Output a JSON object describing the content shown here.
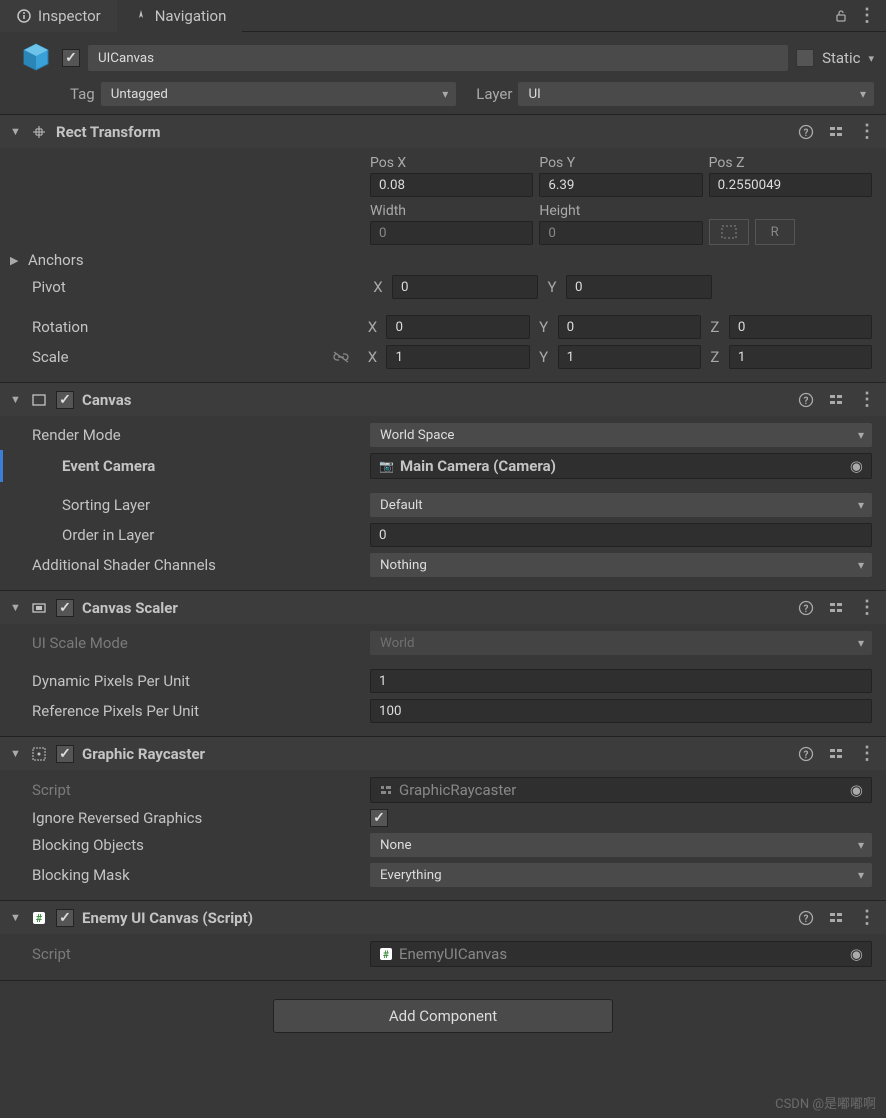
{
  "tabs": {
    "inspector": "Inspector",
    "navigation": "Navigation"
  },
  "header": {
    "name": "UICanvas",
    "static_label": "Static",
    "tag_label": "Tag",
    "tag_value": "Untagged",
    "layer_label": "Layer",
    "layer_value": "UI"
  },
  "rect": {
    "title": "Rect Transform",
    "posx_lbl": "Pos X",
    "posy_lbl": "Pos Y",
    "posz_lbl": "Pos Z",
    "posx": "0.08",
    "posy": "6.39",
    "posz": "0.2550049",
    "width_lbl": "Width",
    "height_lbl": "Height",
    "width": "0",
    "height": "0",
    "anchors_lbl": "Anchors",
    "pivot_lbl": "Pivot",
    "pivot_x": "0",
    "pivot_y": "0",
    "rotation_lbl": "Rotation",
    "rot_x": "0",
    "rot_y": "0",
    "rot_z": "0",
    "scale_lbl": "Scale",
    "scl_x": "1",
    "scl_y": "1",
    "scl_z": "1",
    "X": "X",
    "Y": "Y",
    "Z": "Z",
    "R": "R"
  },
  "canvas": {
    "title": "Canvas",
    "render_mode_lbl": "Render Mode",
    "render_mode": "World Space",
    "event_camera_lbl": "Event Camera",
    "event_camera": "Main Camera (Camera)",
    "sorting_layer_lbl": "Sorting Layer",
    "sorting_layer": "Default",
    "order_lbl": "Order in Layer",
    "order": "0",
    "addchan_lbl": "Additional Shader Channels",
    "addchan": "Nothing"
  },
  "scaler": {
    "title": "Canvas Scaler",
    "mode_lbl": "UI Scale Mode",
    "mode": "World",
    "dppu_lbl": "Dynamic Pixels Per Unit",
    "dppu": "1",
    "rppu_lbl": "Reference Pixels Per Unit",
    "rppu": "100"
  },
  "raycaster": {
    "title": "Graphic Raycaster",
    "script_lbl": "Script",
    "script": "GraphicRaycaster",
    "ignore_lbl": "Ignore Reversed Graphics",
    "blocking_lbl": "Blocking Objects",
    "blocking": "None",
    "mask_lbl": "Blocking Mask",
    "mask": "Everything"
  },
  "enemy": {
    "title": "Enemy UI Canvas (Script)",
    "script_lbl": "Script",
    "script": "EnemyUICanvas"
  },
  "add_component": "Add Component",
  "watermark": "CSDN @是嘟嘟啊"
}
